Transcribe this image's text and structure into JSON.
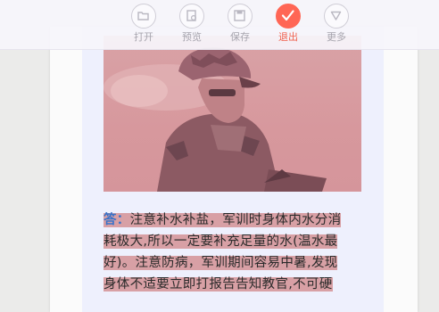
{
  "toolbar": {
    "buttons": [
      {
        "label": "打开",
        "icon": "folder-icon"
      },
      {
        "label": "预览",
        "icon": "preview-icon"
      },
      {
        "label": "保存",
        "icon": "save-icon"
      },
      {
        "label": "退出",
        "icon": "check-exit-icon",
        "active": true
      },
      {
        "label": "更多",
        "icon": "chevron-down-icon"
      }
    ],
    "accent_color": "#ff6655"
  },
  "document": {
    "image": {
      "description_icon": "soldier-photo"
    },
    "answer": {
      "label": "答：",
      "text_lines": [
        "注意补水补盐，军训时身体内水分消",
        "耗极大,所以一定要补充足量的水(温水最",
        "好)。注意防病，军训期间容易中暑,发现",
        "身体不适要立即打报告告知教官,不可硬"
      ]
    },
    "highlight_color": "#d8a0a5"
  }
}
